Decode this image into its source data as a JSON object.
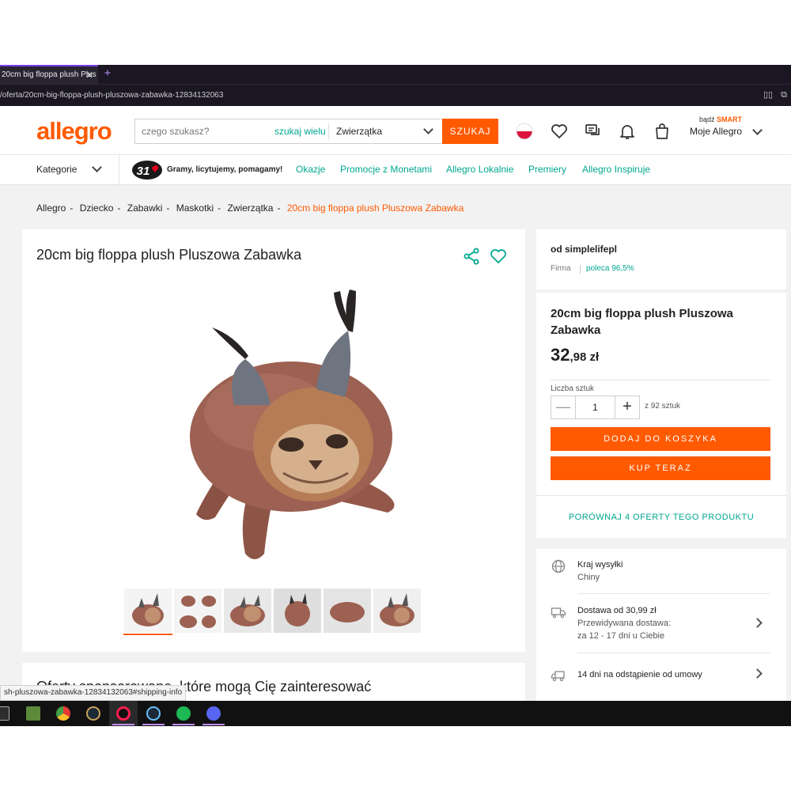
{
  "browser": {
    "tab_title": "20cm big floppa plush Plus",
    "url": "/oferta/20cm-big-floppa-plush-pluszowa-zabawka-12834132063",
    "status_url": "sh-pluszowa-zabawka-12834132063#shipping-info"
  },
  "header": {
    "logo": "allegro",
    "search_placeholder": "czego szukasz?",
    "search_many": "szukaj wielu",
    "search_category": "Zwierzątka",
    "search_button": "SZUKAJ",
    "smart_prefix": "bądź",
    "smart_label": "SMART",
    "account": "Moje Allegro"
  },
  "nav": {
    "categories": "Kategorie",
    "wosp_number": "31",
    "promo_text": "Gramy, licytujemy, pomagamy!",
    "links": [
      "Okazje",
      "Promocje z Monetami",
      "Allegro Lokalnie",
      "Premiery",
      "Allegro Inspiruje"
    ]
  },
  "breadcrumbs": [
    "Allegro",
    "Dziecko",
    "Zabawki",
    "Maskotki",
    "Zwierzątka"
  ],
  "breadcrumb_current": "20cm big floppa plush Pluszowa Zabawka",
  "product": {
    "title": "20cm big floppa plush Pluszowa Zabawka",
    "thumbnail_count": 6,
    "active_thumbnail": 1
  },
  "seller": {
    "name": "od simplelifepl",
    "type": "Firma",
    "recommend": "poleca 96,5%"
  },
  "buybox": {
    "title": "20cm big floppa plush Pluszowa Zabawka",
    "price_main": "32",
    "price_decimal": ",98 zł",
    "qty_label": "Liczba sztuk",
    "qty_value": "1",
    "qty_of": "z 92 sztuk",
    "add_to_cart": "DODAJ DO KOSZYKA",
    "buy_now": "KUP TERAZ",
    "compare": "PORÓWNAJ 4 OFERTY TEGO PRODUKTU"
  },
  "shipping": {
    "country_label": "Kraj wysyłki",
    "country": "Chiny",
    "delivery_title": "Dostawa od 30,99 zł",
    "delivery_expected": "Przewidywana dostawa:",
    "delivery_when": "za 12 - 17 dni u Ciebie",
    "returns": "14 dni na odstąpienie od umowy"
  },
  "sponsored_heading": "Oferty sponsorowane, które mogą Cię zainteresować",
  "colors": {
    "brand": "#ff5a00",
    "link": "#00a790"
  },
  "taskbar_icons": [
    "epic-games-icon",
    "minecraft-icon",
    "chrome-icon",
    "league-of-legends-icon",
    "opera-gx-icon",
    "steam-icon",
    "spotify-icon",
    "discord-icon"
  ]
}
